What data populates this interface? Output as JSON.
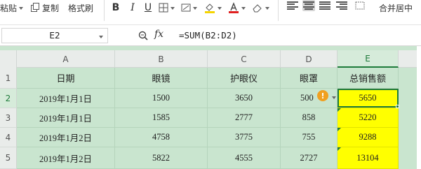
{
  "ribbon": {
    "paste_label": "粘贴",
    "copy_label": "复制",
    "format_painter_label": "格式刷",
    "bold_label": "B",
    "italic_label": "I",
    "underline_label": "U",
    "merge_center_label": "合并居中",
    "icons": [
      "paste-icon",
      "copy-icon",
      "format-painter-icon",
      "bold-icon",
      "italic-icon",
      "underline-icon",
      "border-icon",
      "cell-style-icon",
      "fill-color-icon",
      "font-color-icon",
      "clear-icon",
      "align-icon",
      "merge-icon"
    ]
  },
  "formula_bar": {
    "name_box": "E2",
    "fx_label": "fx",
    "formula": "=SUM(B2:D2)",
    "icons": [
      "zoom-icon",
      "fx-icon"
    ]
  },
  "sheet": {
    "columns": [
      "A",
      "B",
      "C",
      "D",
      "E"
    ],
    "rows": [
      "1",
      "2",
      "3",
      "4",
      "5"
    ],
    "header": [
      "日期",
      "眼镜",
      "护眼仪",
      "眼罩",
      "总销售额"
    ],
    "data": [
      [
        "2019年1月1日",
        "1500",
        "3650",
        "500",
        "5650"
      ],
      [
        "2019年1月1日",
        "1585",
        "2777",
        "858",
        "5220"
      ],
      [
        "2019年1月2日",
        "4758",
        "3775",
        "755",
        "9288"
      ],
      [
        "2019年1月2日",
        "5822",
        "4555",
        "2727",
        "13104"
      ]
    ],
    "selected_cell": "E2",
    "warning_icon_label": "!",
    "colors": {
      "grid_fill": "#c9e5cf",
      "highlight": "#ffff00",
      "selection": "#1e7a3a",
      "warning": "#f0a020"
    }
  }
}
